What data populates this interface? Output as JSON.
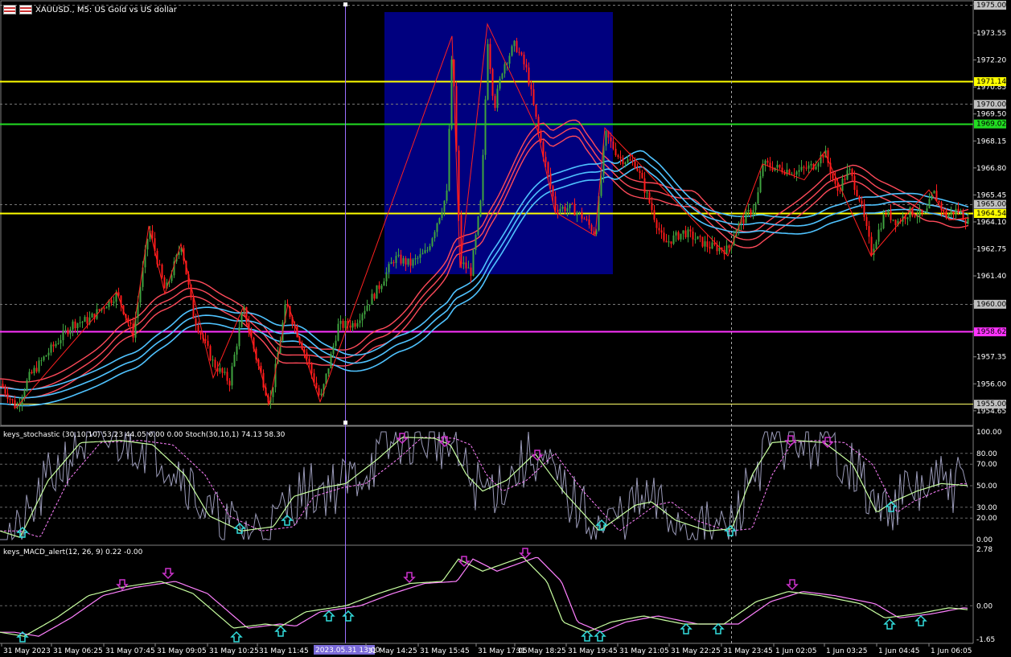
{
  "window": {
    "symbol_title": "XAUUSD., M5: US Gold vs US dollar",
    "stoch_title": "keys_stochastic (30,10,10) 53.23 44.05 0.00 0.00 Stoch(30,10,1) 74.13 58.30",
    "macd_title": "keys_MACD_alert(12, 26, 9) 0.22 -0.00"
  },
  "colors": {
    "background": "#000000",
    "bull_candle": "#3fa33f",
    "bear_candle": "#ff1a1a",
    "highlight_box": "#00007f",
    "zigzag": "#ff2020",
    "ma_blue": "#4fc3ff",
    "ma_red": "#ff4a5a",
    "line_yellow": "#ffff00",
    "line_green": "#22dd22",
    "line_magenta": "#ff33ff",
    "stoch_main": "#c8ffa0",
    "stoch_signal": "#ff80ff",
    "stoch_raw": "#9a9ab8",
    "arrow_down": "#cc33cc",
    "arrow_up": "#33dddd"
  },
  "price_axis": {
    "min": 1954.0,
    "max": 1975.0,
    "ticks": [
      "1975.00",
      "1973.55",
      "1972.20",
      "1970.85",
      "1969.50",
      "1968.15",
      "1966.80",
      "1965.45",
      "1964.10",
      "1962.75",
      "1961.40",
      "1960.00",
      "1958.65",
      "1957.35",
      "1956.00",
      "1954.65"
    ]
  },
  "horizontal_levels": [
    {
      "label": "1971.14",
      "price": 1971.14,
      "kind": "yellow"
    },
    {
      "label": "1970.00",
      "price": 1970.0,
      "kind": "dashed"
    },
    {
      "label": "1969.02",
      "price": 1969.02,
      "kind": "green"
    },
    {
      "label": "1965.00",
      "price": 1965.0,
      "kind": "dashed"
    },
    {
      "label": "1964.54",
      "price": 1964.54,
      "kind": "yellow"
    },
    {
      "label": "1960.00",
      "price": 1960.0,
      "kind": "dashed"
    },
    {
      "label": "1958.62",
      "price": 1958.62,
      "kind": "magenta"
    },
    {
      "label": "1955.00",
      "price": 1955.0,
      "kind": "yellowthin"
    }
  ],
  "stoch_axis": {
    "min": 0,
    "max": 100,
    "ticks": [
      "100.00",
      "80.00",
      "70.00",
      "50.00",
      "30.00",
      "20.00",
      "0.00"
    ]
  },
  "macd_axis": {
    "min": -1.65,
    "max": 2.78,
    "ticks": [
      "2.78",
      "0.00",
      "-1.65"
    ]
  },
  "time_axis": {
    "labels": [
      "31 May 2023",
      "31 May 06:25",
      "31 May 07:45",
      "31 May 09:05",
      "31 May 10:25",
      "31 May 11:45",
      "2023.05.31 13:00",
      "31 May 14:25",
      "31 May 15:45",
      "31 May 17:05",
      "31 May 18:25",
      "31 May 19:45",
      "31 May 21:05",
      "31 May 22:25",
      "31 May 23:45",
      "1 Jun 02:05",
      "1 Jun 03:25",
      "1 Jun 04:45",
      "1 Jun 06:05"
    ],
    "crosshair_label": "2023.05.31 13:00"
  }
}
